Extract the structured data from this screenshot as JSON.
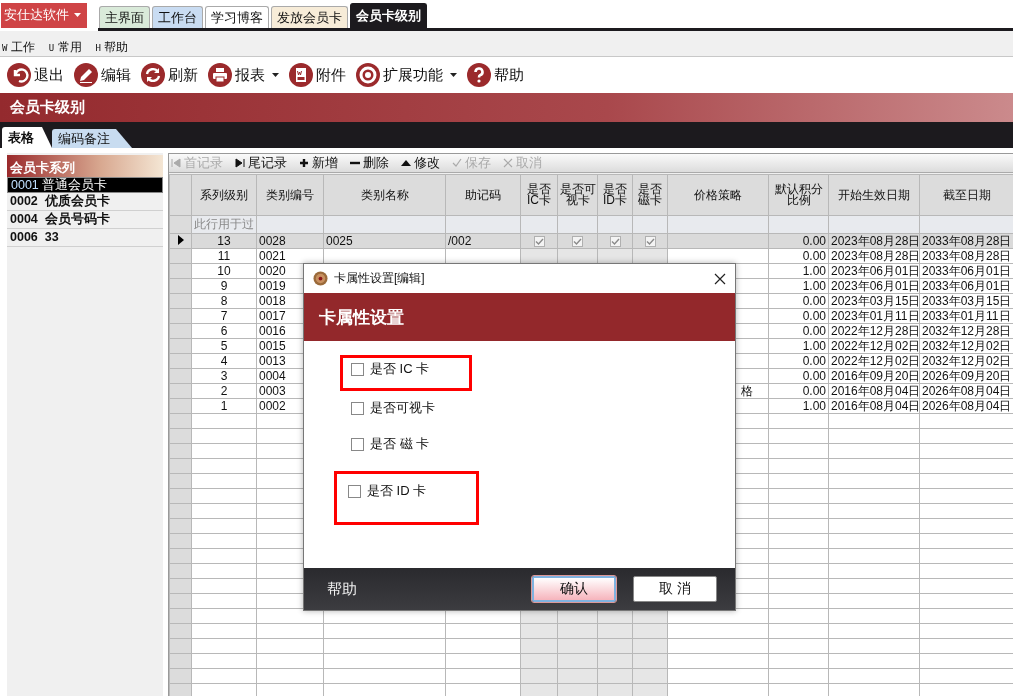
{
  "app_menu": {
    "label": "安仕达软件"
  },
  "top_tabs": [
    {
      "label": "主界面",
      "selected": false,
      "color": "#d9ead9"
    },
    {
      "label": "工作台",
      "selected": false,
      "color": "#c9dcf2"
    },
    {
      "label": "学习博客",
      "selected": false,
      "color": "#ffffff"
    },
    {
      "label": "发放会员卡",
      "selected": false,
      "color": "#f7ecd8"
    },
    {
      "label": "会员卡级别",
      "selected": true,
      "color": "#1c1a1e"
    }
  ],
  "menu": [
    {
      "key": "W",
      "label": "工作"
    },
    {
      "key": "U",
      "label": "常用"
    },
    {
      "key": "H",
      "label": "帮助"
    }
  ],
  "toolbar": [
    {
      "kind": "exit",
      "label": "退出",
      "dropdown": false
    },
    {
      "kind": "edit",
      "label": "编辑",
      "dropdown": false
    },
    {
      "kind": "refresh",
      "label": "刷新",
      "dropdown": false
    },
    {
      "kind": "print",
      "label": "报表",
      "dropdown": true
    },
    {
      "kind": "attach",
      "label": "附件",
      "dropdown": false
    },
    {
      "kind": "extend",
      "label": "扩展功能",
      "dropdown": true
    },
    {
      "kind": "help",
      "label": "帮助",
      "dropdown": false
    }
  ],
  "page_title": "会员卡级别",
  "view_tabs": [
    {
      "label": "表格",
      "selected": true
    },
    {
      "label": "编码备注",
      "selected": false
    }
  ],
  "series_panel": {
    "title": "会员卡系列",
    "items": [
      {
        "code": "0001",
        "name": "普通会员卡",
        "selected": true
      },
      {
        "code": "0002",
        "name": "优质会员卡",
        "selected": false
      },
      {
        "code": "0004",
        "name": "会员号码卡",
        "selected": false
      },
      {
        "code": "0006",
        "name": "33",
        "selected": false
      }
    ]
  },
  "grid": {
    "toolbar": [
      {
        "kind": "first",
        "label": "首记录",
        "disabled": true
      },
      {
        "kind": "last",
        "label": "尾记录",
        "disabled": false
      },
      {
        "kind": "add",
        "label": "新增",
        "disabled": false
      },
      {
        "kind": "delete",
        "label": "删除",
        "disabled": false
      },
      {
        "kind": "modify",
        "label": "修改",
        "disabled": false
      },
      {
        "kind": "save",
        "label": "保存",
        "disabled": true
      },
      {
        "kind": "cancel",
        "label": "取消",
        "disabled": true
      }
    ],
    "columns": [
      {
        "label": "系列级别",
        "kind": "center"
      },
      {
        "label": "类别编号",
        "kind": "text"
      },
      {
        "label": "类别名称",
        "kind": "text"
      },
      {
        "label": "助记码",
        "kind": "text"
      },
      {
        "label": "是否IC卡",
        "kind": "check"
      },
      {
        "label": "是否可视卡",
        "kind": "check"
      },
      {
        "label": "是否ID卡",
        "kind": "check"
      },
      {
        "label": "是否磁卡",
        "kind": "check"
      },
      {
        "label": "价格策略",
        "kind": "tail"
      },
      {
        "label": "默认积分比例",
        "kind": "number"
      },
      {
        "label": "开始生效日期",
        "kind": "text"
      },
      {
        "label": "截至日期",
        "kind": "text"
      }
    ],
    "filter_hint": "此行用于过",
    "rows": [
      {
        "current": true,
        "level": "13",
        "code": "0028",
        "name": "0025",
        "mnemonic": "/002",
        "ic": true,
        "visible": true,
        "id": true,
        "magnetic": true,
        "ratio": "0.00",
        "start": "2023年08月28日",
        "end": "2033年08月28日"
      },
      {
        "current": false,
        "level": "11",
        "code": "0021",
        "ratio": "0.00",
        "start": "2023年08月28日",
        "end": "2033年08月28日"
      },
      {
        "current": false,
        "level": "10",
        "code": "0020",
        "ratio": "1.00",
        "start": "2023年06月01日",
        "end": "2033年06月01日"
      },
      {
        "current": false,
        "level": "9",
        "code": "0019",
        "ratio": "1.00",
        "start": "2023年06月01日",
        "end": "2033年06月01日"
      },
      {
        "current": false,
        "level": "8",
        "code": "0018",
        "ratio": "0.00",
        "start": "2023年03月15日",
        "end": "2033年03月15日"
      },
      {
        "current": false,
        "level": "7",
        "code": "0017",
        "ratio": "0.00",
        "start": "2023年01月11日",
        "end": "2033年01月11日"
      },
      {
        "current": false,
        "level": "6",
        "code": "0016",
        "ratio": "0.00",
        "start": "2022年12月28日",
        "end": "2032年12月28日"
      },
      {
        "current": false,
        "level": "5",
        "code": "0015",
        "ratio": "1.00",
        "start": "2022年12月02日",
        "end": "2032年12月02日"
      },
      {
        "current": false,
        "level": "4",
        "code": "0013",
        "ratio": "0.00",
        "start": "2022年12月02日",
        "end": "2032年12月02日"
      },
      {
        "current": false,
        "level": "3",
        "code": "0004",
        "ratio": "0.00",
        "start": "2016年09月20日",
        "end": "2026年09月20日"
      },
      {
        "current": false,
        "level": "2",
        "code": "0003",
        "price": "格",
        "ratio": "0.00",
        "start": "2016年08月04日",
        "end": "2026年08月04日"
      },
      {
        "current": false,
        "level": "1",
        "code": "0002",
        "ratio": "1.00",
        "start": "2016年08月04日",
        "end": "2026年08月04日"
      }
    ]
  },
  "dialog": {
    "title": "卡属性设置[编辑]",
    "heading": "卡属性设置",
    "options": [
      {
        "label": "是否 IC 卡",
        "checked": false,
        "highlighted": true
      },
      {
        "label": "是否可视卡",
        "checked": false,
        "highlighted": false
      },
      {
        "label": "是否 磁 卡",
        "checked": false,
        "highlighted": false
      },
      {
        "label": "是否 ID 卡",
        "checked": false,
        "highlighted": true
      }
    ],
    "help": "帮助",
    "buttons": [
      {
        "label": "确认",
        "focused": true
      },
      {
        "label": "取 消",
        "focused": false
      }
    ]
  }
}
